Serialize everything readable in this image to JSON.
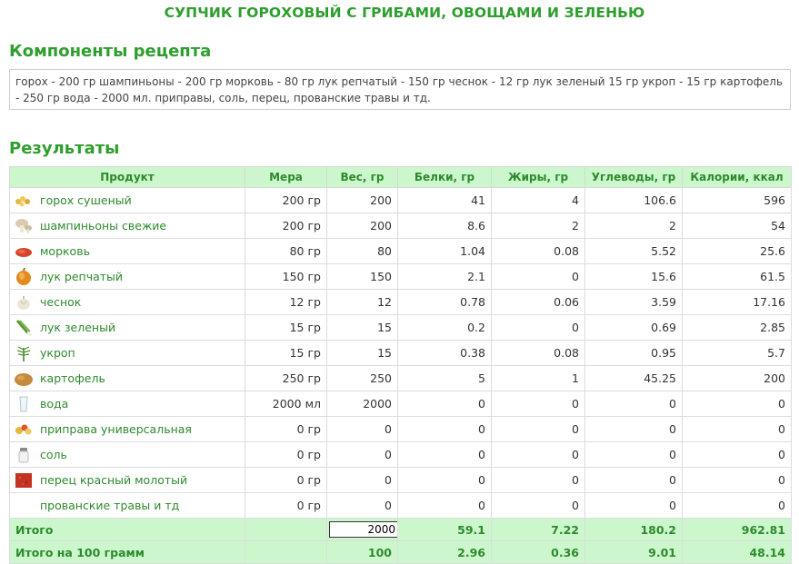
{
  "page": {
    "title": "СУПЧИК ГОРОХОВЫЙ С ГРИБАМИ, ОВОЩАМИ И ЗЕЛЕНЬЮ",
    "components_heading": "Компоненты рецепта",
    "components_text": "горох - 200 гр шампиньоны - 200 гр морковь - 80 гр лук репчатый - 150 гр чеснок - 12 гр лук зеленый 15 гр укроп - 15 гр картофель - 250 гр вода - 2000 мл. приправы, соль, перец, прованские травы и тд.",
    "results_heading": "Результаты"
  },
  "table": {
    "headers": [
      "Продукт",
      "Мера",
      "Вес, гр",
      "Белки, гр",
      "Жиры, гр",
      "Углеводы, гр",
      "Калории, ккал"
    ],
    "rows": [
      {
        "icon": "peas-icon",
        "name": "горох сушеный",
        "measure": "200 гр",
        "weight": "200",
        "protein": "41",
        "fat": "4",
        "carbs": "106.6",
        "kcal": "596"
      },
      {
        "icon": "mushroom-icon",
        "name": "шампиньоны свежие",
        "measure": "200 гр",
        "weight": "200",
        "protein": "8.6",
        "fat": "2",
        "carbs": "2",
        "kcal": "54"
      },
      {
        "icon": "carrot-icon",
        "name": "морковь",
        "measure": "80 гр",
        "weight": "80",
        "protein": "1.04",
        "fat": "0.08",
        "carbs": "5.52",
        "kcal": "25.6"
      },
      {
        "icon": "onion-icon",
        "name": "лук репчатый",
        "measure": "150 гр",
        "weight": "150",
        "protein": "2.1",
        "fat": "0",
        "carbs": "15.6",
        "kcal": "61.5"
      },
      {
        "icon": "garlic-icon",
        "name": "чеснок",
        "measure": "12 гр",
        "weight": "12",
        "protein": "0.78",
        "fat": "0.06",
        "carbs": "3.59",
        "kcal": "17.16"
      },
      {
        "icon": "green-onion-icon",
        "name": "лук зеленый",
        "measure": "15 гр",
        "weight": "15",
        "protein": "0.2",
        "fat": "0",
        "carbs": "0.69",
        "kcal": "2.85"
      },
      {
        "icon": "dill-icon",
        "name": "укроп",
        "measure": "15 гр",
        "weight": "15",
        "protein": "0.38",
        "fat": "0.08",
        "carbs": "0.95",
        "kcal": "5.7"
      },
      {
        "icon": "potato-icon",
        "name": "картофель",
        "measure": "250 гр",
        "weight": "250",
        "protein": "5",
        "fat": "1",
        "carbs": "45.25",
        "kcal": "200"
      },
      {
        "icon": "water-glass-icon",
        "name": "вода",
        "measure": "2000 мл",
        "weight": "2000",
        "protein": "0",
        "fat": "0",
        "carbs": "0",
        "kcal": "0"
      },
      {
        "icon": "seasoning-icon",
        "name": "приправа универсальная",
        "measure": "0 гр",
        "weight": "0",
        "protein": "0",
        "fat": "0",
        "carbs": "0",
        "kcal": "0"
      },
      {
        "icon": "salt-shaker-icon",
        "name": "соль",
        "measure": "0 гр",
        "weight": "0",
        "protein": "0",
        "fat": "0",
        "carbs": "0",
        "kcal": "0"
      },
      {
        "icon": "red-pepper-icon",
        "name": "перец красный молотый",
        "measure": "0 гр",
        "weight": "0",
        "protein": "0",
        "fat": "0",
        "carbs": "0",
        "kcal": "0"
      },
      {
        "icon": "",
        "name": "прованские травы и тд",
        "measure": "0 гр",
        "weight": "0",
        "protein": "0",
        "fat": "0",
        "carbs": "0",
        "kcal": "0"
      }
    ],
    "total": {
      "label": "Итого",
      "weight_input": "2000",
      "protein": "59.1",
      "fat": "7.22",
      "carbs": "180.2",
      "kcal": "962.81"
    },
    "per100": {
      "label": "Итого на 100 грамм",
      "weight": "100",
      "protein": "2.96",
      "fat": "0.36",
      "carbs": "9.01",
      "kcal": "48.14"
    }
  },
  "colors": {
    "accent": "#2e9e2e",
    "header_bg": "#ccf7cc"
  }
}
